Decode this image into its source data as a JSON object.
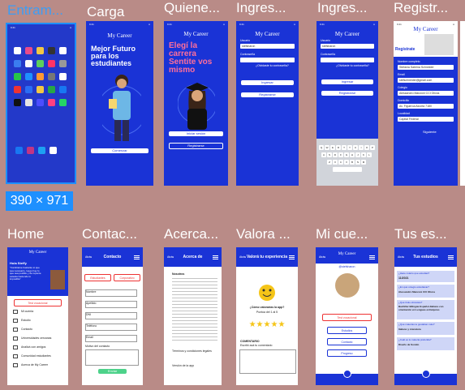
{
  "frames": [
    {
      "label": "Entram...",
      "selected": true
    },
    {
      "label": "Carga"
    },
    {
      "label": "Quiene..."
    },
    {
      "label": "Ingres..."
    },
    {
      "label": "Ingres..."
    },
    {
      "label": "Registr..."
    },
    {
      "label": "Home"
    },
    {
      "label": "Contac..."
    },
    {
      "label": "Acerca..."
    },
    {
      "label": "Valora ..."
    },
    {
      "label": "Mi cue..."
    },
    {
      "label": "Tus es..."
    }
  ],
  "size_badge": "390 × 971",
  "brand": "My Career",
  "carga": {
    "headline": "Mejor Futuro para los estudiantes",
    "button": "Comenzar"
  },
  "quienes": {
    "headline": "Elegí la carrera Sentite vos mismo",
    "btn1": "Iniciar sesión",
    "btn2": "Registrarse"
  },
  "login": {
    "user_label": "Usuario",
    "user_value": "stefsharon",
    "pass_label": "Contraseña",
    "forgot": "¿Olvidaste tu contraseña?",
    "btn1": "Ingresar",
    "btn2": "Registrarse"
  },
  "registro": {
    "title": "Registrate",
    "fields": [
      {
        "label": "Nombre completo",
        "value": "Stefania Sabrina Schneider"
      },
      {
        "label": "Email",
        "value": "stefschneider@gmail.com"
      },
      {
        "label": "Colegio",
        "value": "Alessandro Manzoni CCI Olivos"
      },
      {
        "label": "Domicilio",
        "value": "Av. Figueroa Alcorta 7180"
      },
      {
        "label": "Localidad",
        "value": "Capital Federal"
      }
    ],
    "next": "Siguiente"
  },
  "home": {
    "greeting": "Hola Steffy",
    "quote": "\"Cambiarse bastante si que sea necesario, luego hay lo que sea posible y de repente estarás haciendo lo imposible\"",
    "test_btn": "Test vocacional",
    "items": [
      "Mi cuenta",
      "Estudio",
      "Contacto",
      "Universidades cercanas",
      "Analizá con amigos",
      "Comunidad estudiantes",
      "Acerca de My Career"
    ]
  },
  "contacto": {
    "back": "Atrás",
    "title": "Contacto",
    "tab1": "Estudiantes",
    "tab2": "Corporativo",
    "fields": [
      "Nombre",
      "Apellido",
      "DNI",
      "Teléfono",
      "Email"
    ],
    "reason": "Motivo del contacto",
    "send": "Enviar"
  },
  "acerca": {
    "back": "Atrás",
    "title": "Acerca de",
    "section1": "Nosotros",
    "section2": "Términos y condiciones legales",
    "section3": "Versión de la app"
  },
  "valora": {
    "back": "Atrás",
    "title": "Valorá tu experiencia",
    "question": "¿Cómo valorarías la app?",
    "score": "Puntúa del 1 al 5",
    "stars": "★★★★★",
    "comment_label": "COMENTARIO",
    "comment_hint": "Escribí acá tu comentario"
  },
  "cuenta": {
    "back": "Atrás",
    "handle": "@stefsharon",
    "test_btn": "Test vocacional",
    "rows": [
      "Estudios",
      "Contacto",
      "Progreso"
    ]
  },
  "estudios": {
    "back": "Atrás",
    "title": "Tus estudios",
    "qa": [
      {
        "q": "¿Hace cuánto que estudias?",
        "a": "11/2021"
      },
      {
        "q": "¿En qué colegio estudiaste?",
        "a": "Alessandro Manzoni CCI Olivos"
      },
      {
        "q": "¿Qué título obtuviste?",
        "a": "Bachiller Bilingüe Español-Italiano con orientación en Lenguas extranjeras"
      },
      {
        "q": "¿Qué materias te gustaban más?",
        "a": "Italiano y Literatura"
      },
      {
        "q": "¿Cuál es tu materia preferida?",
        "a": "Diseño de Sonido"
      }
    ]
  }
}
